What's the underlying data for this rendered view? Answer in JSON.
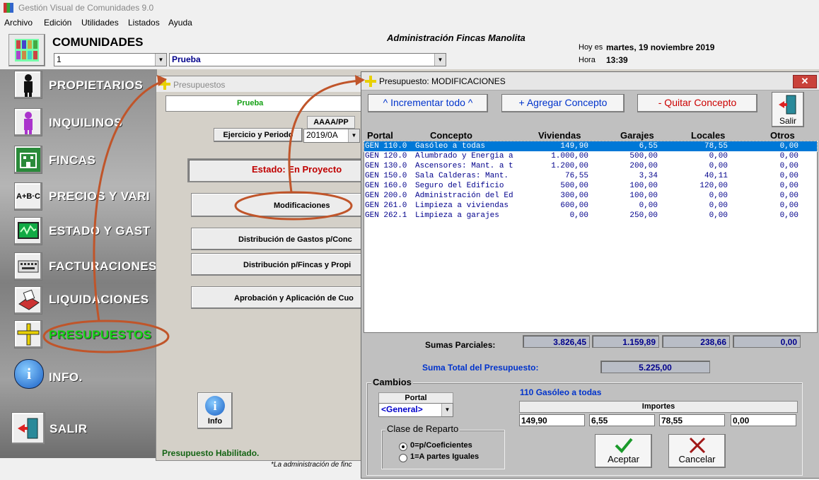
{
  "window": {
    "title": "Gestión  Visual de Comunidades  9.0"
  },
  "menu": [
    "Archivo",
    "Edición",
    "Utilidades",
    "Listados",
    "Ayuda"
  ],
  "header": {
    "section_title": "COMUNIDADES",
    "company": "Administración Fincas Manolita",
    "community_code": "1",
    "community_name": "Prueba",
    "date_label": "Hoy es",
    "date_value": "martes, 19 noviembre 2019",
    "time_label": "Hora",
    "time_value": "13:39"
  },
  "nav": [
    {
      "label": "PROPIETARIOS",
      "icon": "person-icon"
    },
    {
      "label": "INQUILINOS",
      "icon": "tenant-icon"
    },
    {
      "label": "FINCAS",
      "icon": "building-icon"
    },
    {
      "label": "PRECIOS Y VARI",
      "icon": "abc-icon"
    },
    {
      "label": "ESTADO  Y  GAST",
      "icon": "monitor-icon"
    },
    {
      "label": "FACTURACIONES",
      "icon": "keyboard-icon"
    },
    {
      "label": "LIQUIDACIONES",
      "icon": "printer-icon"
    },
    {
      "label": "PRESUPUESTOS",
      "icon": "ruler-icon"
    },
    {
      "label": "INFO.",
      "icon": "info-icon"
    },
    {
      "label": "SALIR",
      "icon": "exit-door-icon"
    }
  ],
  "presupuestos": {
    "title": "Presupuestos",
    "community": "Prueba",
    "period_header": "AAAA/PP",
    "period_label": "Ejercicio y Periodo",
    "period_value": "2019/0A",
    "estado": "Estado:  En Proyecto",
    "buttons": [
      "Modificaciones",
      "Distribución de Gastos p/Conc",
      "Distribución p/Fincas y Propi",
      "Aprobación y Aplicación de Cuo"
    ],
    "info_label": "Info",
    "status": "Presupuesto Habilitado.",
    "footer_note": "*La administración de finc"
  },
  "modificaciones": {
    "title": "Presupuesto:  MODIFICACIONES",
    "btn_increment": "^ Incrementar todo ^",
    "btn_add": "+ Agregar Concepto",
    "btn_remove": "- Quitar Concepto",
    "btn_exit": "Salir",
    "columns": [
      "Portal",
      "Concepto",
      "Viviendas",
      "Garajes",
      "Locales",
      "Otros"
    ],
    "rows": [
      [
        "GEN 110.0",
        "Gasóleo a todas",
        "149,90",
        "6,55",
        "78,55",
        "0,00"
      ],
      [
        "GEN 120.0",
        "Alumbrado y Energia a",
        "1.000,00",
        "500,00",
        "0,00",
        "0,00"
      ],
      [
        "GEN 130.0",
        "Ascensores: Mant. a t",
        "1.200,00",
        "200,00",
        "0,00",
        "0,00"
      ],
      [
        "GEN 150.0",
        "Sala Calderas: Mant.",
        "76,55",
        "3,34",
        "40,11",
        "0,00"
      ],
      [
        "GEN 160.0",
        "Seguro del Edificio",
        "500,00",
        "100,00",
        "120,00",
        "0,00"
      ],
      [
        "GEN 200.0",
        "Administración del Ed",
        "300,00",
        "100,00",
        "0,00",
        "0,00"
      ],
      [
        "GEN 261.0",
        "Limpieza a viviendas",
        "600,00",
        "0,00",
        "0,00",
        "0,00"
      ],
      [
        "GEN 262.1",
        "Limpieza a garajes",
        "0,00",
        "250,00",
        "0,00",
        "0,00"
      ]
    ],
    "sums_label": "Sumas Parciales:",
    "sums": [
      "3.826,45",
      "1.159,89",
      "238,66",
      "0,00"
    ],
    "total_label": "Suma Total del Presupuesto:",
    "total": "5.225,00",
    "cambios": {
      "title": "Cambios",
      "portal_label": "Portal",
      "portal_value": "<General>",
      "concept_selected": "110 Gasóleo a todas",
      "importes_label": "Importes",
      "importes": [
        "149,90",
        "6,55",
        "78,55",
        "0,00"
      ],
      "clase_title": "Clase de Reparto",
      "option1": "0=p/Coeficientes",
      "option2": "1=A partes Iguales",
      "accept": "Aceptar",
      "cancel": "Cancelar"
    }
  },
  "colors": {
    "selected_row": "#0078d7",
    "estado_red": "#c00000",
    "link_blue": "#0000cc",
    "menu_green": "#14d414"
  }
}
